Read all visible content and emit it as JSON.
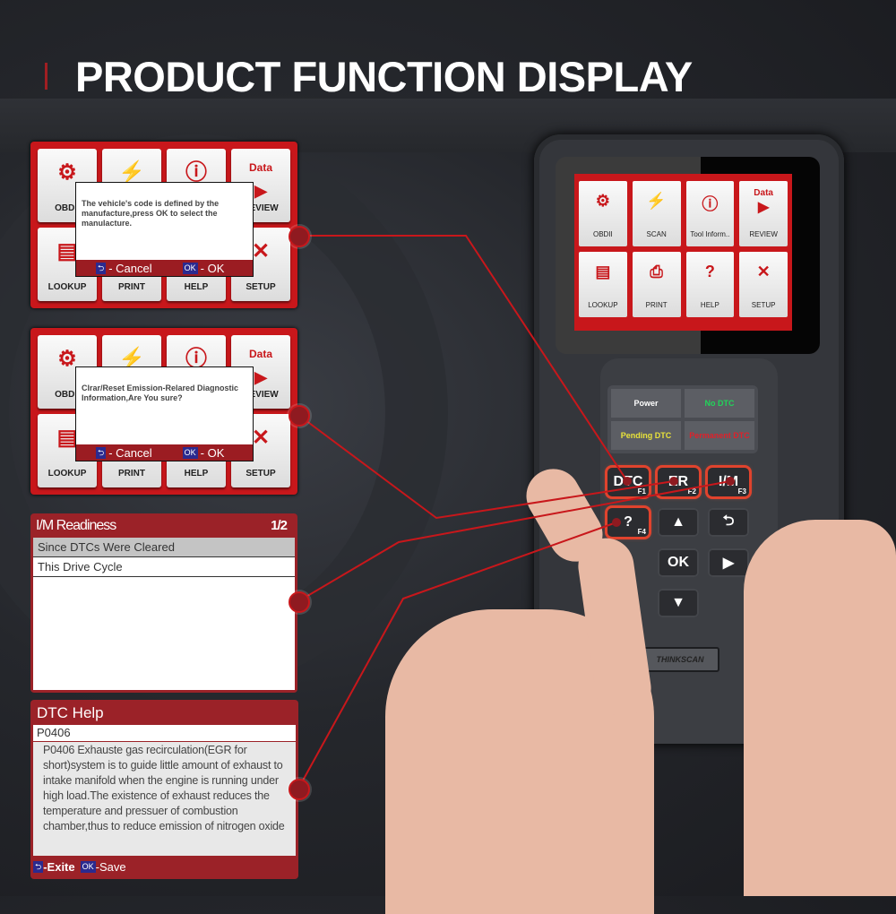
{
  "title": "PRODUCT FUNCTION DISPLAY",
  "colors": {
    "accent": "#c8171b",
    "panel_dark": "#9b2228",
    "key_blue": "#2b2a8f"
  },
  "menu_tiles": [
    {
      "label": "OBDII",
      "icon": "engine-icon"
    },
    {
      "label": "SCAN",
      "icon": "scan-icon"
    },
    {
      "label": "Tool Inform..",
      "icon": "info-icon"
    },
    {
      "label": "REVIEW",
      "icon": "data-review-icon",
      "icon_text": "Data"
    },
    {
      "label": "LOOKUP",
      "icon": "lookup-icon"
    },
    {
      "label": "PRINT",
      "icon": "printer-icon"
    },
    {
      "label": "HELP",
      "icon": "help-icon"
    },
    {
      "label": "SETUP",
      "icon": "setup-icon"
    }
  ],
  "dialog1": {
    "message": "The vehicle's code is defined by the manufacture,press OK to select the manulacture.",
    "cancel_label": "- Cancel",
    "ok_key": "OK",
    "ok_label": "- OK"
  },
  "dialog2": {
    "message": "Clrar/Reset Emission-Relared Diagnostic Information,Are You sure?",
    "cancel_label": "- Cancel",
    "ok_key": "OK",
    "ok_label": "- OK"
  },
  "im_readiness": {
    "title": "I/M Readiness",
    "page": "1/2",
    "items": [
      "Since DTCs Were Cleared",
      "This Drive Cycle"
    ]
  },
  "dtc_help": {
    "title": "DTC Help",
    "code": "P0406",
    "description": "P0406 Exhauste gas recirculation(EGR for short)system is to guide little amount of exhaust to intake manifold when the engine is running under high load.The existence of exhaust reduces the temperature and pressuer of combustion chamber,thus to reduce emission of nitrogen oxide",
    "exit_label": "-Exite",
    "ok_key": "OK",
    "save_label": "-Save"
  },
  "device": {
    "leds": [
      {
        "label": "Power",
        "color": "#ffffff"
      },
      {
        "label": "No DTC",
        "color": "#22d45a"
      },
      {
        "label": "Pending DTC",
        "color": "#e8e23a"
      },
      {
        "label": "Permanent DTC",
        "color": "#e0202a"
      }
    ],
    "keys": {
      "dtc": "DTC",
      "dtc_f": "F1",
      "er": "ER",
      "er_f": "F2",
      "im": "I/M",
      "im_f": "F3",
      "help_f": "F4",
      "ok": "OK"
    },
    "brand": "THINKSCAN"
  }
}
